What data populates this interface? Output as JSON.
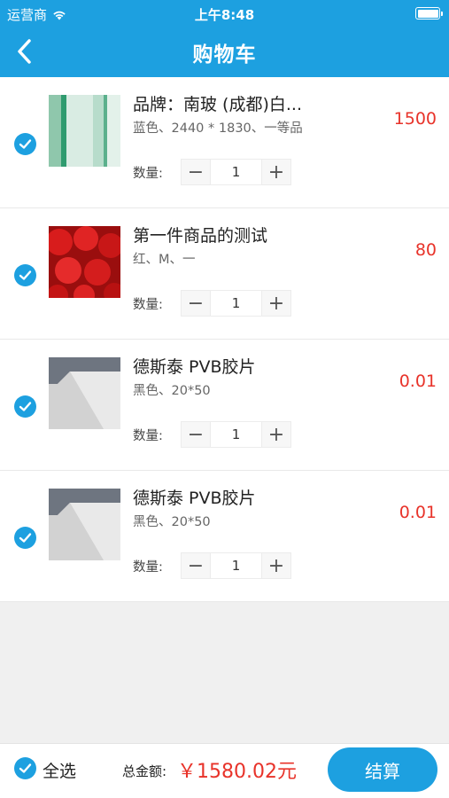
{
  "status": {
    "carrier": "运营商",
    "time": "上午8:48"
  },
  "nav": {
    "title": "购物车"
  },
  "items": [
    {
      "name": "品牌：南玻 (成都)白...",
      "spec": "蓝色、2440 *  1830、一等品",
      "price": "1500",
      "qty_label": "数量:",
      "qty": "1"
    },
    {
      "name": "第一件商品的测试",
      "spec": "红、M、一",
      "price": "80",
      "qty_label": "数量:",
      "qty": "1"
    },
    {
      "name": "德斯泰 PVB胶片",
      "spec": "黑色、20*50",
      "price": "0.01",
      "qty_label": "数量:",
      "qty": "1"
    },
    {
      "name": "德斯泰 PVB胶片",
      "spec": "黑色、20*50",
      "price": "0.01",
      "qty_label": "数量:",
      "qty": "1"
    }
  ],
  "footer": {
    "select_all": "全选",
    "total_label": "总金额:",
    "total": "￥1580.02元",
    "checkout": "结算"
  },
  "colors": {
    "accent": "#1da0e0",
    "price": "#e8332a"
  }
}
